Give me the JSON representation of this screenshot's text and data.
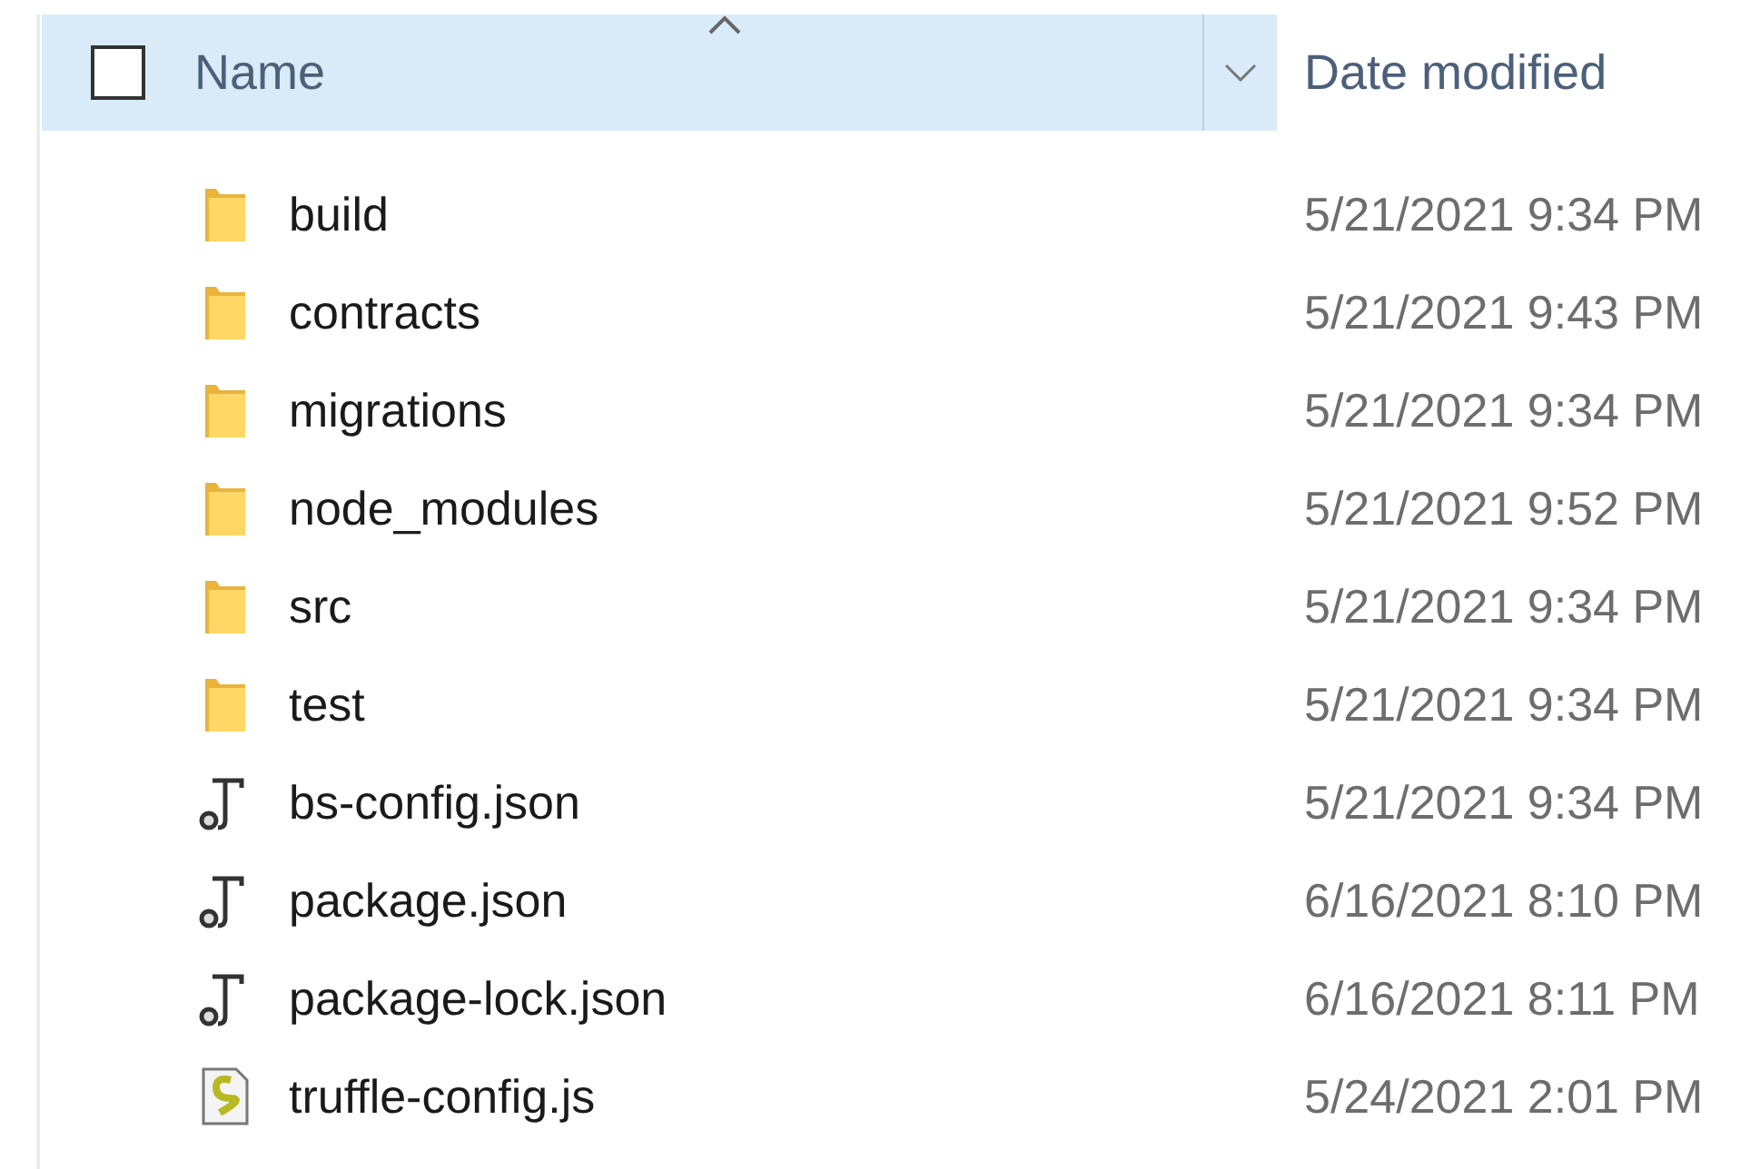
{
  "header": {
    "select_all": {
      "checked": false
    },
    "columns": [
      {
        "label": "Name",
        "sorted_ascending": true
      },
      {
        "label": "Date modified"
      }
    ]
  },
  "rows": [
    {
      "kind": "folder",
      "name": "build",
      "date": "5/21/2021 9:34 PM",
      "selected": false
    },
    {
      "kind": "folder",
      "name": "contracts",
      "date": "5/21/2021 9:43 PM",
      "selected": false
    },
    {
      "kind": "folder",
      "name": "migrations",
      "date": "5/21/2021 9:34 PM",
      "selected": false
    },
    {
      "kind": "folder",
      "name": "node_modules",
      "date": "5/21/2021 9:52 PM",
      "selected": false
    },
    {
      "kind": "folder",
      "name": "src",
      "date": "5/21/2021 9:34 PM",
      "selected": false
    },
    {
      "kind": "folder",
      "name": "test",
      "date": "5/21/2021 9:34 PM",
      "selected": false
    },
    {
      "kind": "json",
      "name": "bs-config.json",
      "date": "5/21/2021 9:34 PM",
      "selected": false
    },
    {
      "kind": "json",
      "name": "package.json",
      "date": "6/16/2021 8:10 PM",
      "selected": false
    },
    {
      "kind": "json",
      "name": "package-lock.json",
      "date": "6/16/2021 8:11 PM",
      "selected": false
    },
    {
      "kind": "script",
      "name": "truffle-config.js",
      "date": "5/24/2021 2:01 PM",
      "selected": false
    }
  ]
}
